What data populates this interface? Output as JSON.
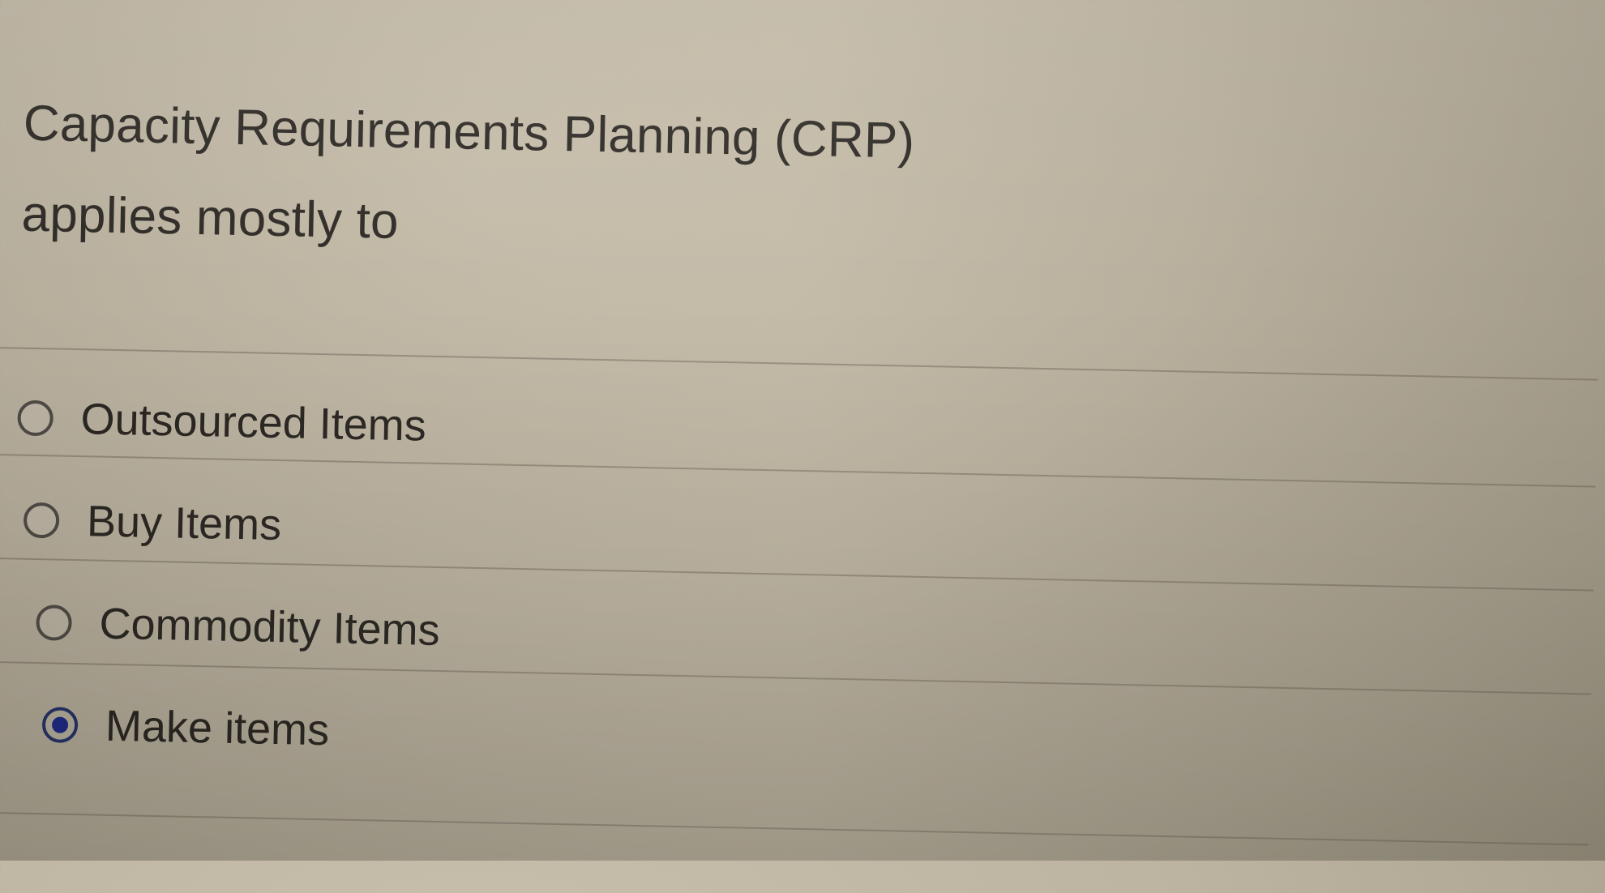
{
  "question": {
    "line1": "Capacity Requirements Planning (CRP)",
    "line2": "applies mostly to"
  },
  "options": [
    {
      "label": "Outsourced Items",
      "selected": false
    },
    {
      "label": "Buy Items",
      "selected": false
    },
    {
      "label": "Commodity Items",
      "selected": false
    },
    {
      "label": "Make items",
      "selected": true
    }
  ],
  "colors": {
    "background": "#bdb4a1",
    "text": "#23201c",
    "selected_radio": "#1f2a86",
    "radio_border": "#514d47"
  },
  "icons": {
    "unselected": "radio-unselected-icon",
    "selected": "radio-selected-icon"
  }
}
